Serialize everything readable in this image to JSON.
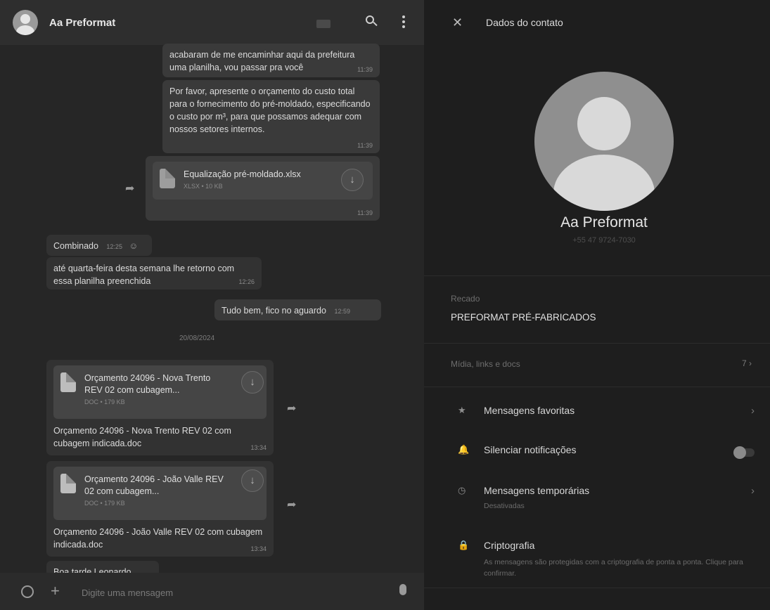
{
  "chat": {
    "title": "Aa Preformat",
    "messages": [
      {
        "text": "acabaram de me encaminhar aqui da prefeitura uma planilha, vou passar pra você",
        "time": "11:39"
      },
      {
        "text": "Por favor, apresente o orçamento do custo total para o fornecimento do pré-moldado, especificando o custo por m³, para que possamos adequar com nossos setores internos.",
        "time": "11:39"
      },
      {
        "file_name": "Equalização pré-moldado.xlsx",
        "file_meta": "XLSX • 10 KB",
        "time": "11:39"
      },
      {
        "text": "Combinado",
        "time": "12:25"
      },
      {
        "text": "até quarta-feira desta semana lhe retorno com essa planilha preenchida",
        "time": "12:26"
      },
      {
        "text": "Tudo bem, fico no aguardo",
        "time": "12:59"
      },
      {
        "file_name": "Orçamento 24096 - Nova Trento REV 02 com cubagem...",
        "file_meta": "DOC • 179 KB",
        "caption": "Orçamento 24096 - Nova Trento REV 02 com cubagem indicada.doc",
        "time": "13:34"
      },
      {
        "file_name": "Orçamento 24096 - João Valle REV 02 com cubagem...",
        "file_meta": "DOC • 179 KB",
        "caption": "Orçamento 24096 - João Valle REV 02 com cubagem indicada.doc",
        "time": "13:34"
      },
      {
        "text": "Boa tarde Leonardo"
      }
    ],
    "date_separator": "20/08/2024",
    "input_placeholder": "Digite uma mensagem"
  },
  "contact": {
    "header_title": "Dados do contato",
    "name": "Aa Preformat",
    "phone": "+55 47 9724-7030",
    "about_label": "Recado",
    "about_text": "PREFORMAT PRÉ-FABRICADOS",
    "media_label": "Mídia, links e docs",
    "media_count": "7",
    "rows": [
      {
        "icon": "star-icon",
        "label": "Mensagens favoritas"
      },
      {
        "icon": "bell-icon",
        "label": "Silenciar notificações"
      },
      {
        "icon": "timer-icon",
        "label": "Mensagens temporárias",
        "sub": "Desativadas"
      },
      {
        "icon": "lock-icon",
        "label": "Criptografia",
        "sub": "As mensagens são protegidas com a criptografia de ponta a ponta. Clique para confirmar."
      }
    ]
  }
}
